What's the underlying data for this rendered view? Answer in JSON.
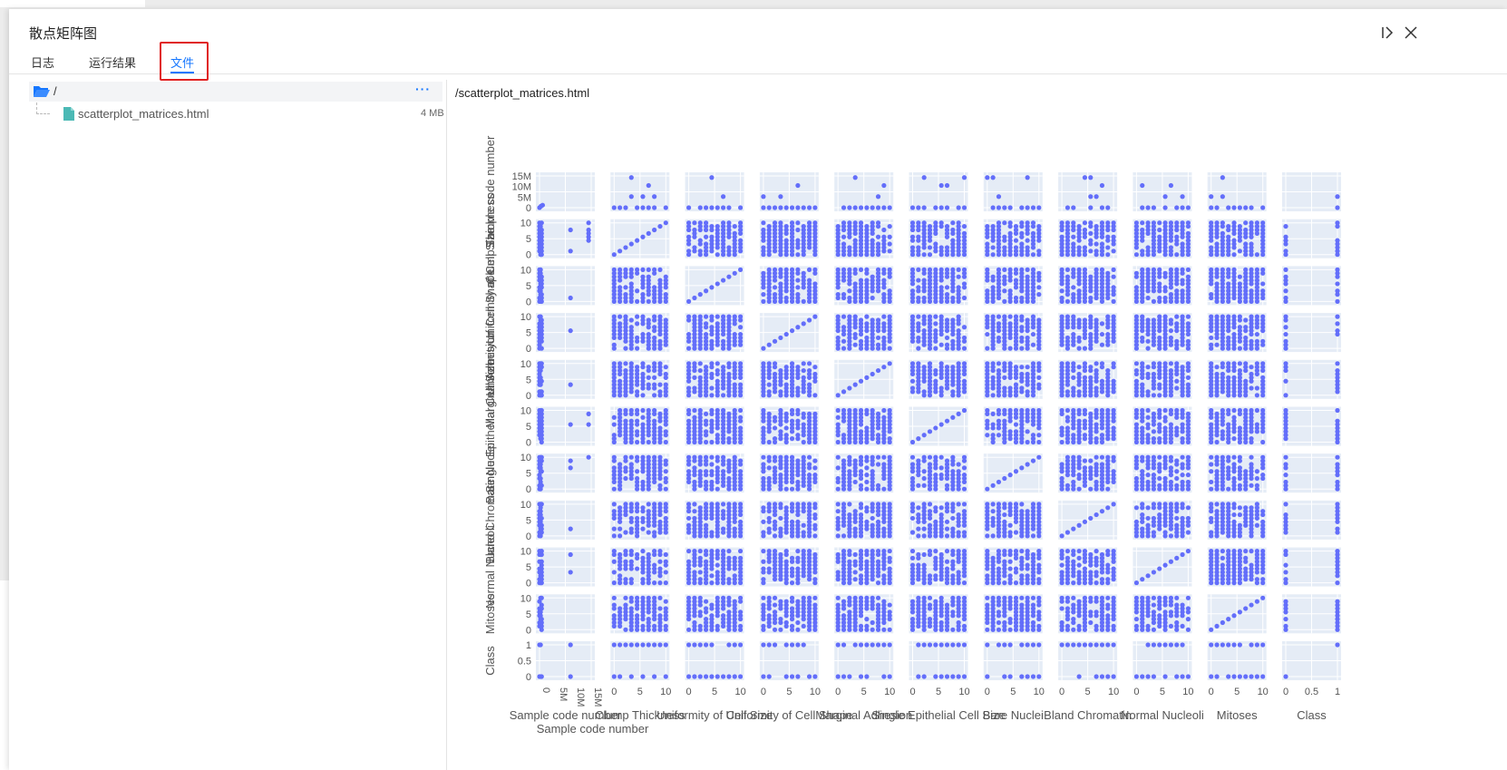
{
  "window": {
    "title": "散点矩阵图"
  },
  "tabs": [
    {
      "label": "日志",
      "active": false
    },
    {
      "label": "运行结果",
      "active": false
    },
    {
      "label": "文件",
      "active": true
    }
  ],
  "file_tree": {
    "root": {
      "name": "/",
      "more_label": "···"
    },
    "files": [
      {
        "name": "scatterplot_matrices.html",
        "size": "4 MB"
      }
    ]
  },
  "preview": {
    "path": "/scatterplot_matrices.html"
  },
  "colors": {
    "accent": "#1677ff",
    "highlight": "#e02020",
    "marker": "#636efa",
    "plot_bg": "#e5ecf6",
    "file_icon": "#4bb9b5"
  },
  "chart_data": {
    "type": "scatter",
    "subtype": "scatter-matrix",
    "dimensions": [
      "Sample code number",
      "Clump Thickness",
      "Uniformity of Cell Size",
      "Uniformity of Cell Shape",
      "Marginal Adhesion",
      "Single Epithelial Cell Size",
      "Bare Nuclei",
      "Bland Chromatin",
      "Normal Nucleoli",
      "Mitoses",
      "Class"
    ],
    "axis_ticks": {
      "Sample code number": [
        "0",
        "5M",
        "10M",
        "15M"
      ],
      "default": [
        "0",
        "5",
        "10"
      ],
      "Class": [
        "0",
        "0.5",
        "1"
      ]
    },
    "axis_ranges": {
      "Sample code number": [
        0,
        15000000
      ],
      "default": [
        0,
        10
      ],
      "Class": [
        0,
        1
      ]
    },
    "x_axis_title": "Sample code number",
    "grid": true,
    "legend": "none"
  }
}
